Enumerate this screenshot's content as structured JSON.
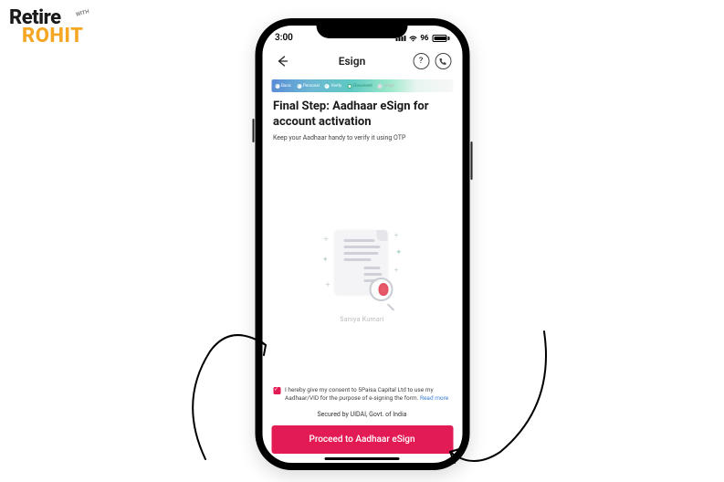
{
  "logo": {
    "line1": "Retire",
    "line2": "ROHIT",
    "tag": "WITH"
  },
  "status": {
    "time": "3:00",
    "battery": "96"
  },
  "header": {
    "title": "Esign"
  },
  "stepper": {
    "s1": "Basic",
    "s2": "Personal",
    "s3": "Verify",
    "s4": "Document",
    "s5": "eSign"
  },
  "main": {
    "title_l1": "Final Step: Aadhaar eSign for",
    "title_l2": "account activation",
    "subtitle": "Keep your Aadhaar handy to verify it using OTP",
    "name": "Saniya  Kumari"
  },
  "consent": {
    "text_a": "I hereby give my consent to 5Paisa Capital Ltd to use my",
    "text_b": "Aadhaar/VID for the purpose of e-signing",
    "text_c": "the form.",
    "read_more": "Read more"
  },
  "footer": {
    "secured": "Secured by UIDAI, Govt. of India",
    "cta": "Proceed to Aadhaar eSign"
  }
}
